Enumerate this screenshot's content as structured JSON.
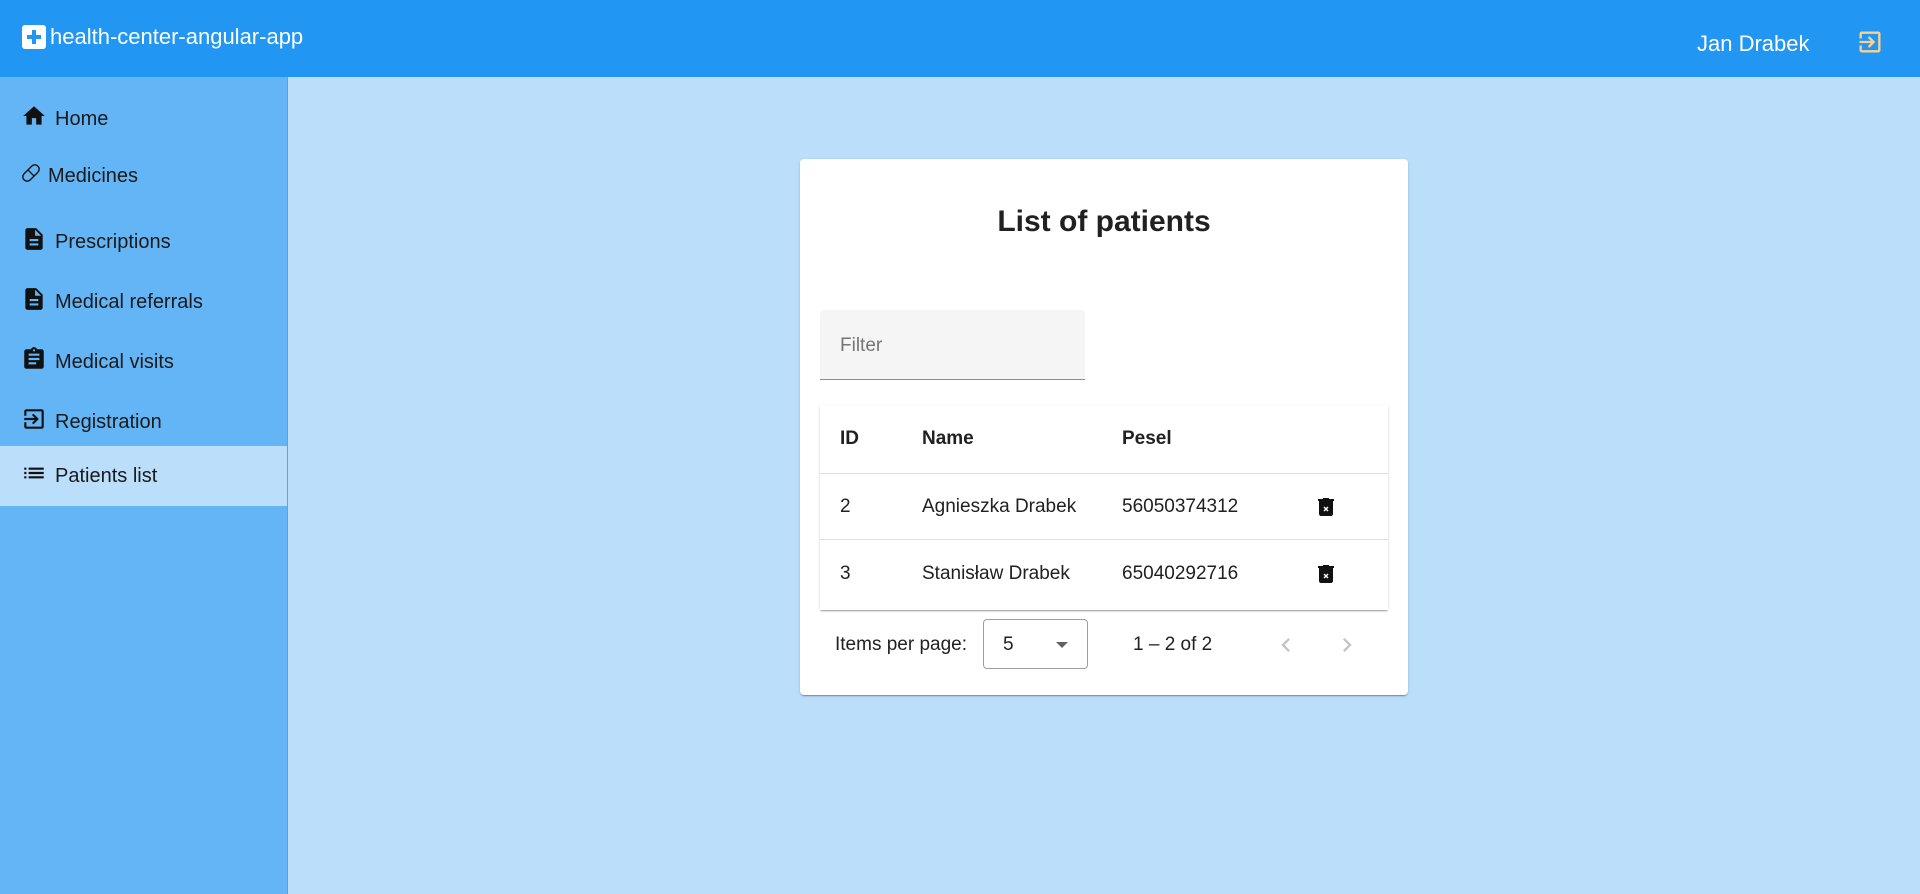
{
  "header": {
    "app_title": "health-center-angular-app",
    "user_name": "Jan Drabek",
    "logout_icon": "logout-icon"
  },
  "sidebar": {
    "items": [
      {
        "label": "Home",
        "icon": "home-icon"
      },
      {
        "label": "Medicines",
        "icon": "pill-icon"
      },
      {
        "label": "Prescriptions",
        "icon": "document-icon"
      },
      {
        "label": "Medical referrals",
        "icon": "document-icon"
      },
      {
        "label": "Medical visits",
        "icon": "clipboard-icon"
      },
      {
        "label": "Registration",
        "icon": "login-icon"
      },
      {
        "label": "Patients list",
        "icon": "list-icon",
        "active": true
      }
    ]
  },
  "main": {
    "title": "List of patients",
    "filter_placeholder": "Filter",
    "table": {
      "columns": [
        "ID",
        "Name",
        "Pesel"
      ],
      "rows": [
        {
          "id": "2",
          "name": "Agnieszka Drabek",
          "pesel": "56050374312"
        },
        {
          "id": "3",
          "name": "Stanisław Drabek",
          "pesel": "65040292716"
        }
      ]
    },
    "paginator": {
      "items_per_page_label": "Items per page:",
      "page_size": "5",
      "range_label": "1 – 2 of 2"
    }
  },
  "colors": {
    "toolbar": "#2196f3",
    "sidebar": "#64b5f6",
    "background": "#bbdefb",
    "logout_icon": "#ffd08a"
  }
}
